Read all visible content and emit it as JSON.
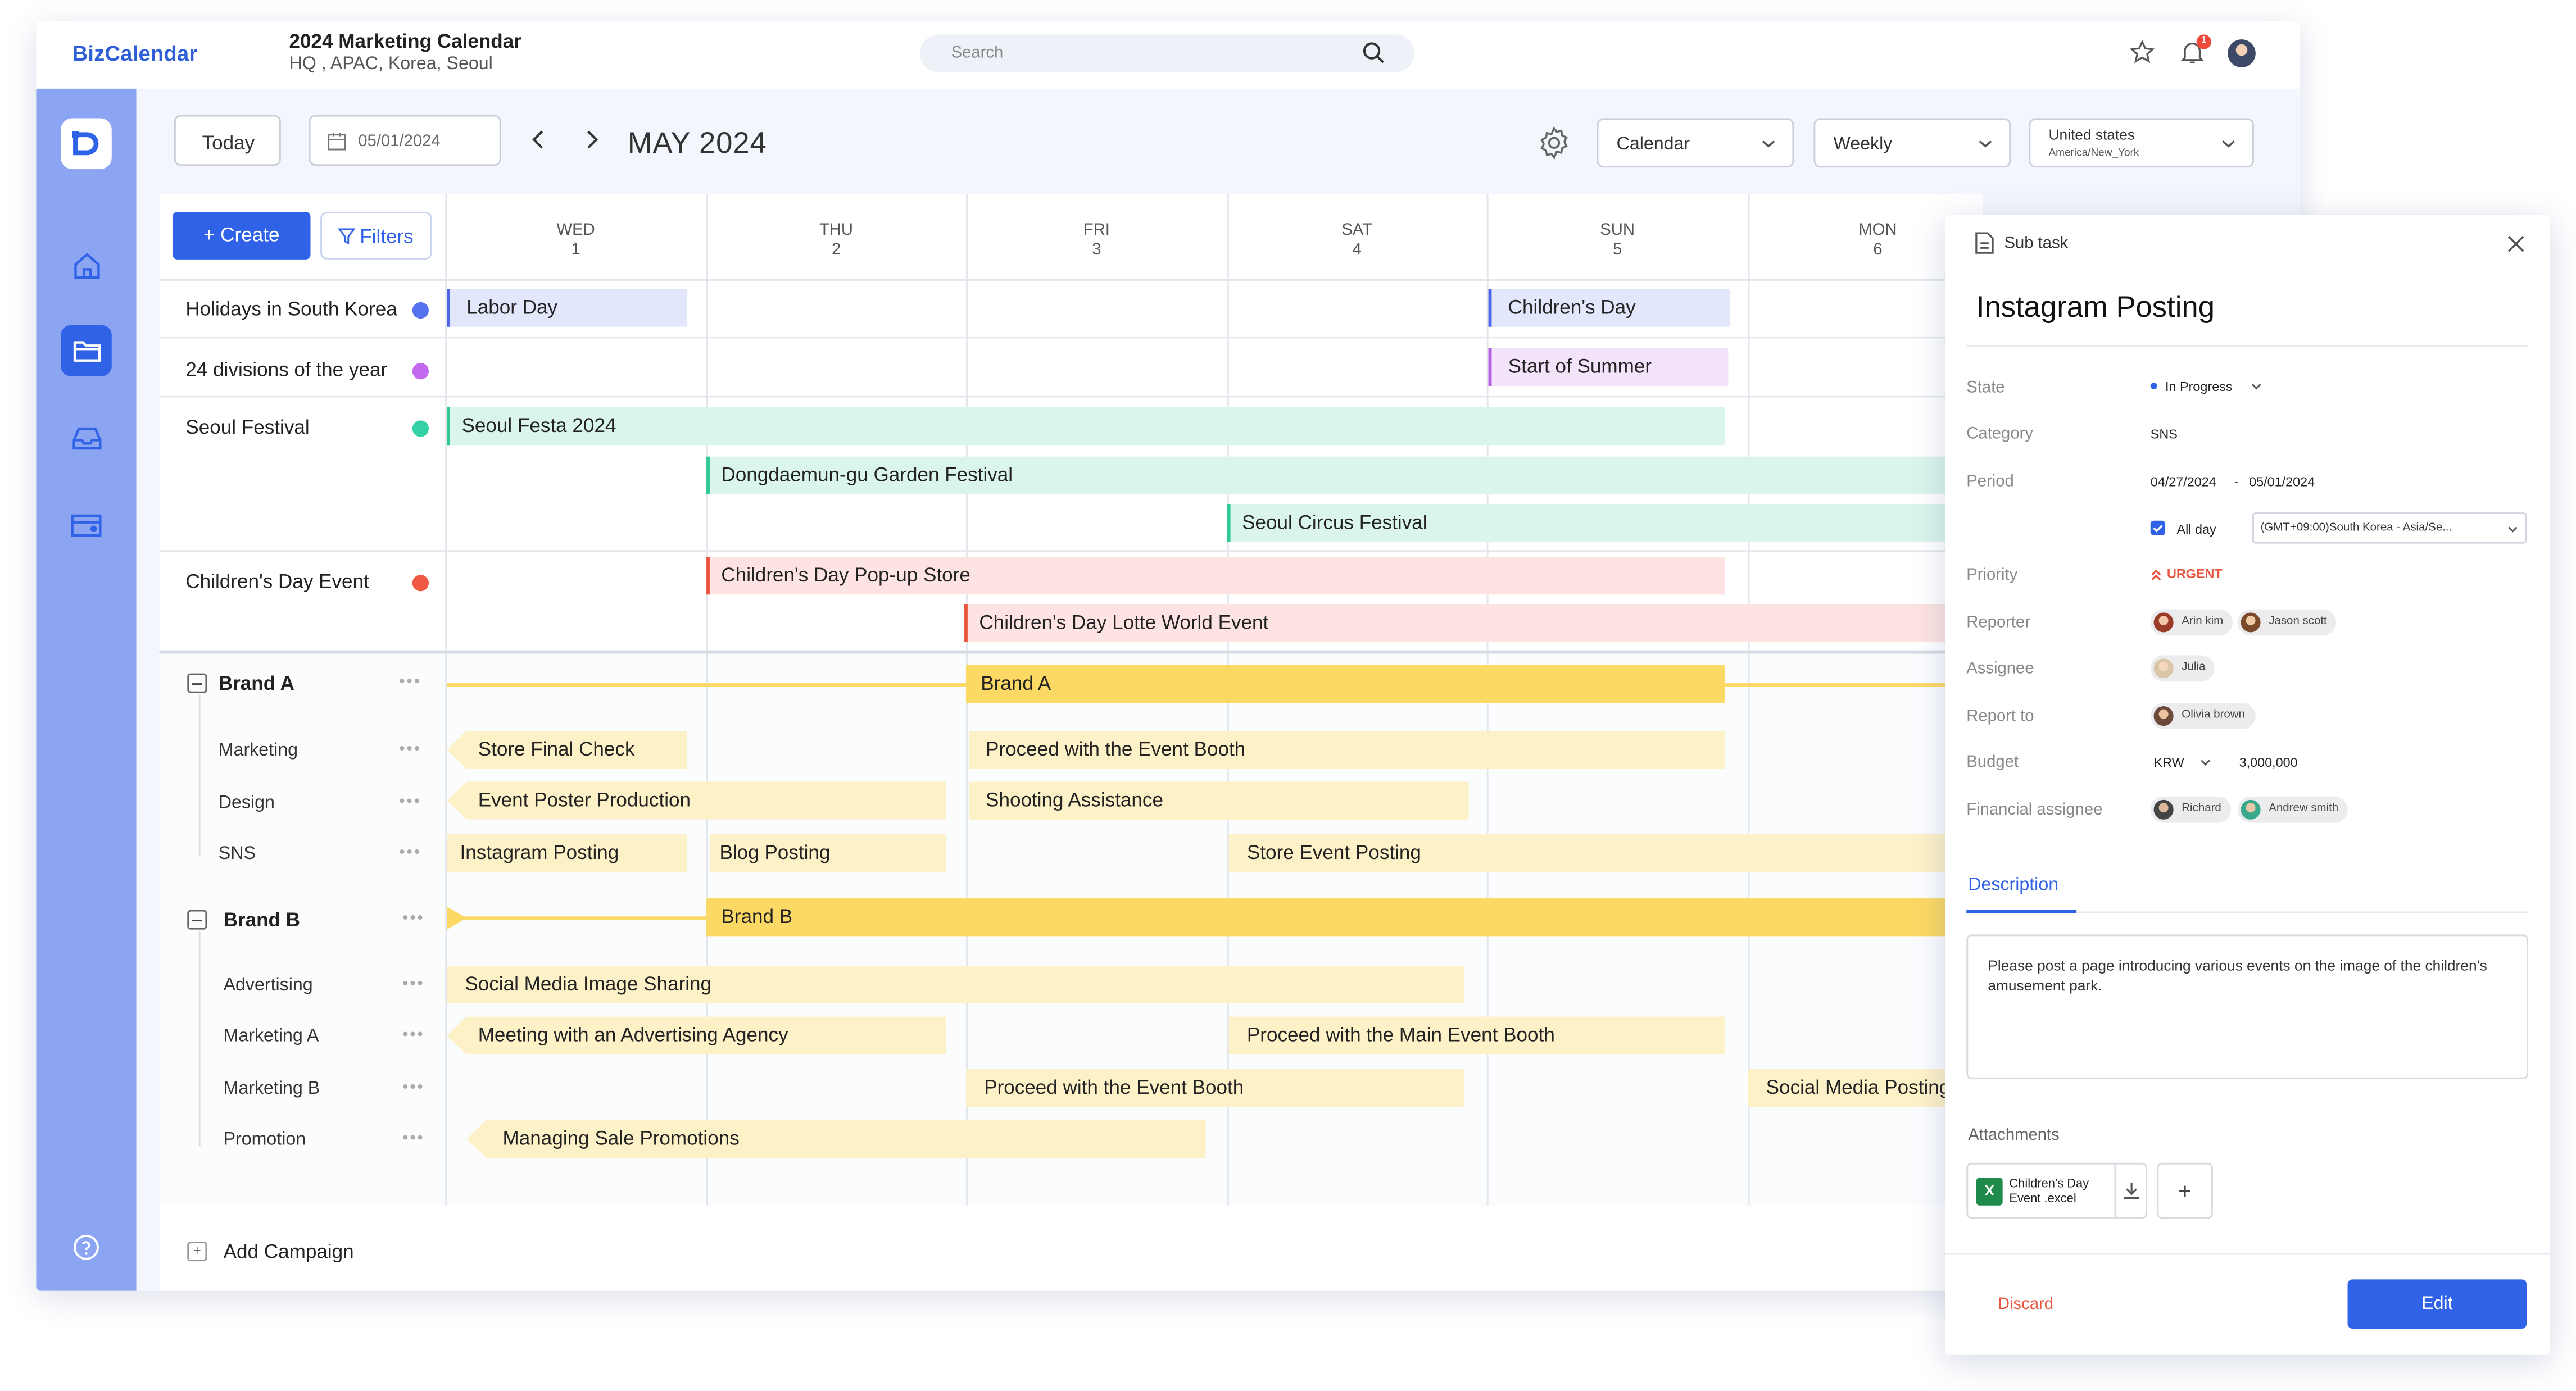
{
  "app": {
    "logo": "BizCalendar",
    "doc_title": "2024 Marketing Calendar",
    "doc_subtitle": "HQ , APAC, Korea, Seoul",
    "search_placeholder": "Search",
    "notification_count": "1"
  },
  "toolbar": {
    "today": "Today",
    "date_value": "05/01/2024",
    "month_label": "MAY 2024",
    "view_select": "Calendar",
    "range_select": "Weekly",
    "timezone_country": "United states",
    "timezone_zone": "America/New_York",
    "create": "+ Create",
    "filters": "Filters"
  },
  "days": [
    {
      "dow": "WED",
      "num": "1"
    },
    {
      "dow": "THU",
      "num": "2"
    },
    {
      "dow": "FRI",
      "num": "3"
    },
    {
      "dow": "SAT",
      "num": "4"
    },
    {
      "dow": "SUN",
      "num": "5"
    },
    {
      "dow": "MON",
      "num": "6"
    }
  ],
  "calendars": [
    {
      "name": "Holidays in South Korea",
      "color": "#5772ee"
    },
    {
      "name": "24 divisions of the year",
      "color": "#c169ef"
    },
    {
      "name": "Seoul Festival",
      "color": "#34d1a4"
    },
    {
      "name": "Children's Day Event",
      "color": "#ef5a44"
    }
  ],
  "events": {
    "labor_day": "Labor Day",
    "childrens_day": "Children's Day",
    "start_of_summer": "Start of Summer",
    "seoul_festa": "Seoul Festa 2024",
    "dongdaemun": "Dongdaemun-gu Garden Festival",
    "circus": "Seoul Circus Festival",
    "popup": "Children's Day Pop-up Store",
    "lotte": "Children's Day Lotte World Event"
  },
  "brand_a": {
    "name": "Brand A",
    "bar": "Brand A",
    "rows": [
      "Marketing",
      "Design",
      "SNS"
    ],
    "tasks": {
      "store_final_check": "Store Final Check",
      "proceed_event_booth": "Proceed with the Event Booth",
      "event_poster": "Event Poster Production",
      "shooting": "Shooting Assistance",
      "instagram": "Instagram Posting",
      "blog": "Blog Posting",
      "store_event_posting": "Store Event Posting"
    }
  },
  "brand_b": {
    "name": "Brand B",
    "bar": "Brand B",
    "rows": [
      "Advertising",
      "Marketing A",
      "Marketing B",
      "Promotion"
    ],
    "tasks": {
      "social_image": "Social Media Image Sharing",
      "meeting_agency": "Meeting with an Advertising Agency",
      "main_event_booth": "Proceed with the Main Event Booth",
      "event_booth": "Proceed with the Event Booth",
      "social_posting": "Social Media Posting",
      "sale_promotions": "Managing Sale Promotions"
    }
  },
  "add_campaign": "Add Campaign",
  "panel": {
    "type": "Sub task",
    "title": "Instagram Posting",
    "labels": {
      "state": "State",
      "category": "Category",
      "period": "Period",
      "priority": "Priority",
      "reporter": "Reporter",
      "assignee": "Assignee",
      "report_to": "Report to",
      "budget": "Budget",
      "financial_assignee": "Financial assignee"
    },
    "state": "In Progress",
    "category": "SNS",
    "period_start": "04/27/2024",
    "period_sep": "-",
    "period_end": "05/01/2024",
    "all_day": "All day",
    "timezone": "(GMT+09:00)South Korea - Asia/Se...",
    "priority": "URGENT",
    "reporters": [
      "Arin kim",
      "Jason scott"
    ],
    "assignee": "Julia",
    "report_to": "Olivia brown",
    "currency": "KRW",
    "budget": "3,000,000",
    "financial_assignees": [
      "Richard",
      "Andrew smith"
    ],
    "tab_description": "Description",
    "description": "Please post a page introducing various events on the image of the children's amusement park.",
    "attachments_label": "Attachments",
    "attachment_name_1": "Children's Day",
    "attachment_name_2": "Event .excel",
    "discard": "Discard",
    "edit": "Edit"
  },
  "colors": {
    "primary": "#2f62e7",
    "sidebar": "#8ca5f2",
    "brand_bar": "#fcd964",
    "task_bar": "#fdf1c7",
    "urgent": "#e8543e"
  }
}
